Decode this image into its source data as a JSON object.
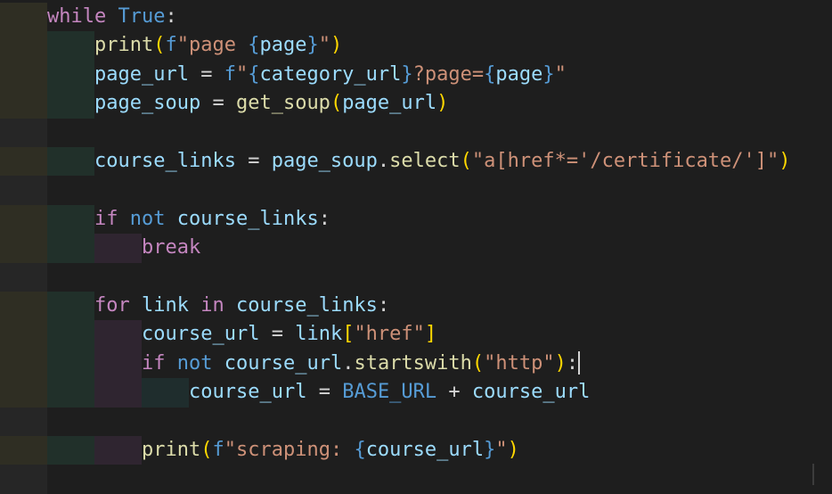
{
  "editor": {
    "lines": [
      {
        "indent": 0,
        "tokens": [
          {
            "t": "while",
            "c": "kw-ctrl"
          },
          {
            "t": " "
          },
          {
            "t": "True",
            "c": "kw-const"
          },
          {
            "t": ":"
          }
        ]
      },
      {
        "indent": 1,
        "tokens": [
          {
            "t": "print",
            "c": "fn"
          },
          {
            "t": "(",
            "c": "p1"
          },
          {
            "t": "f",
            "c": "kw-const"
          },
          {
            "t": "\"page ",
            "c": "str"
          },
          {
            "t": "{",
            "c": "brace"
          },
          {
            "t": "page",
            "c": "var"
          },
          {
            "t": "}",
            "c": "brace"
          },
          {
            "t": "\"",
            "c": "str"
          },
          {
            "t": ")",
            "c": "p1"
          }
        ]
      },
      {
        "indent": 1,
        "tokens": [
          {
            "t": "page_url",
            "c": "var"
          },
          {
            "t": " = "
          },
          {
            "t": "f",
            "c": "kw-const"
          },
          {
            "t": "\"",
            "c": "str"
          },
          {
            "t": "{",
            "c": "brace"
          },
          {
            "t": "category_url",
            "c": "var"
          },
          {
            "t": "}",
            "c": "brace"
          },
          {
            "t": "?page=",
            "c": "str"
          },
          {
            "t": "{",
            "c": "brace"
          },
          {
            "t": "page",
            "c": "var"
          },
          {
            "t": "}",
            "c": "brace"
          },
          {
            "t": "\"",
            "c": "str"
          }
        ]
      },
      {
        "indent": 1,
        "tokens": [
          {
            "t": "page_soup",
            "c": "var"
          },
          {
            "t": " = "
          },
          {
            "t": "get_soup",
            "c": "fn"
          },
          {
            "t": "(",
            "c": "p1"
          },
          {
            "t": "page_url",
            "c": "var"
          },
          {
            "t": ")",
            "c": "p1"
          }
        ]
      },
      {
        "indent": 0,
        "empty": true,
        "tokens": []
      },
      {
        "indent": 1,
        "tokens": [
          {
            "t": "course_links",
            "c": "var"
          },
          {
            "t": " = "
          },
          {
            "t": "page_soup",
            "c": "var"
          },
          {
            "t": "."
          },
          {
            "t": "select",
            "c": "fn"
          },
          {
            "t": "(",
            "c": "p1"
          },
          {
            "t": "\"a[href*='/certificate/']\"",
            "c": "str"
          },
          {
            "t": ")",
            "c": "p1"
          }
        ]
      },
      {
        "indent": 0,
        "empty": true,
        "tokens": []
      },
      {
        "indent": 1,
        "tokens": [
          {
            "t": "if",
            "c": "kw-ctrl"
          },
          {
            "t": " "
          },
          {
            "t": "not",
            "c": "kw-const"
          },
          {
            "t": " "
          },
          {
            "t": "course_links",
            "c": "var"
          },
          {
            "t": ":"
          }
        ]
      },
      {
        "indent": 2,
        "tokens": [
          {
            "t": "break",
            "c": "kw-ctrl"
          }
        ]
      },
      {
        "indent": 0,
        "empty": true,
        "tokens": []
      },
      {
        "indent": 1,
        "tokens": [
          {
            "t": "for",
            "c": "kw-ctrl"
          },
          {
            "t": " "
          },
          {
            "t": "link",
            "c": "var"
          },
          {
            "t": " "
          },
          {
            "t": "in",
            "c": "kw-ctrl"
          },
          {
            "t": " "
          },
          {
            "t": "course_links",
            "c": "var"
          },
          {
            "t": ":"
          }
        ]
      },
      {
        "indent": 2,
        "tokens": [
          {
            "t": "course_url",
            "c": "var"
          },
          {
            "t": " = "
          },
          {
            "t": "link",
            "c": "var"
          },
          {
            "t": "[",
            "c": "p1"
          },
          {
            "t": "\"href\"",
            "c": "str"
          },
          {
            "t": "]",
            "c": "p1"
          }
        ]
      },
      {
        "indent": 2,
        "cursor": true,
        "tokens": [
          {
            "t": "if",
            "c": "kw-ctrl"
          },
          {
            "t": " "
          },
          {
            "t": "not",
            "c": "kw-const"
          },
          {
            "t": " "
          },
          {
            "t": "course_url",
            "c": "var"
          },
          {
            "t": "."
          },
          {
            "t": "startswith",
            "c": "fn"
          },
          {
            "t": "(",
            "c": "p1"
          },
          {
            "t": "\"http\"",
            "c": "str"
          },
          {
            "t": ")",
            "c": "p1"
          },
          {
            "t": ":"
          }
        ]
      },
      {
        "indent": 3,
        "tokens": [
          {
            "t": "course_url",
            "c": "var"
          },
          {
            "t": " = "
          },
          {
            "t": "BASE_URL",
            "c": "kw-const"
          },
          {
            "t": " + "
          },
          {
            "t": "course_url",
            "c": "var"
          }
        ]
      },
      {
        "indent": 0,
        "empty": true,
        "tokens": []
      },
      {
        "indent": 2,
        "tokens": [
          {
            "t": "print",
            "c": "fn"
          },
          {
            "t": "(",
            "c": "p1"
          },
          {
            "t": "f",
            "c": "kw-const"
          },
          {
            "t": "\"scraping: ",
            "c": "str"
          },
          {
            "t": "{",
            "c": "brace"
          },
          {
            "t": "course_url",
            "c": "var"
          },
          {
            "t": "}",
            "c": "brace"
          },
          {
            "t": "\"",
            "c": "str"
          },
          {
            "t": ")",
            "c": "p1"
          }
        ]
      },
      {
        "indent": 0,
        "empty": true,
        "tokens": []
      }
    ]
  }
}
